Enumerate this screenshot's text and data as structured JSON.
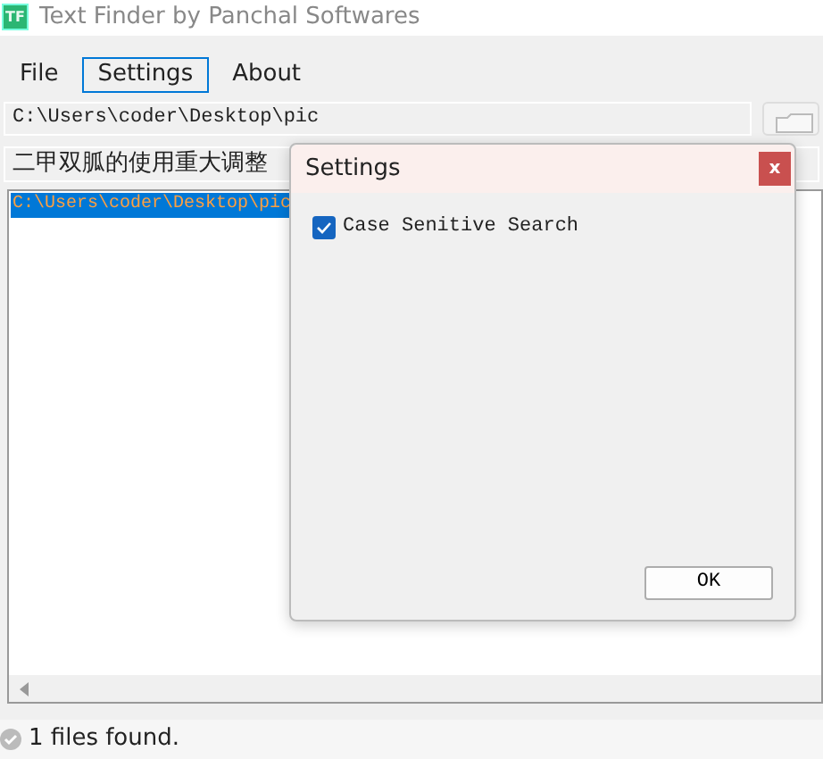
{
  "window": {
    "title": "Text Finder by Panchal Softwares",
    "logo": "TF"
  },
  "menu": [
    {
      "label": "File",
      "selected": false
    },
    {
      "label": "Settings",
      "selected": true
    },
    {
      "label": "About",
      "selected": false
    }
  ],
  "path_field": {
    "value": "C:\\Users\\coder\\Desktop\\pic"
  },
  "search_field": {
    "value": "二甲双胍的使用重大调整"
  },
  "results": [
    {
      "text": "C:\\Users\\coder\\Desktop\\pic",
      "selected": true
    }
  ],
  "status_bar": {
    "text": "1 files found."
  },
  "dialog": {
    "title": "Settings",
    "close": "x",
    "options": [
      {
        "label": "Case Senitive Search",
        "checked": true
      }
    ],
    "ok": "OK"
  }
}
